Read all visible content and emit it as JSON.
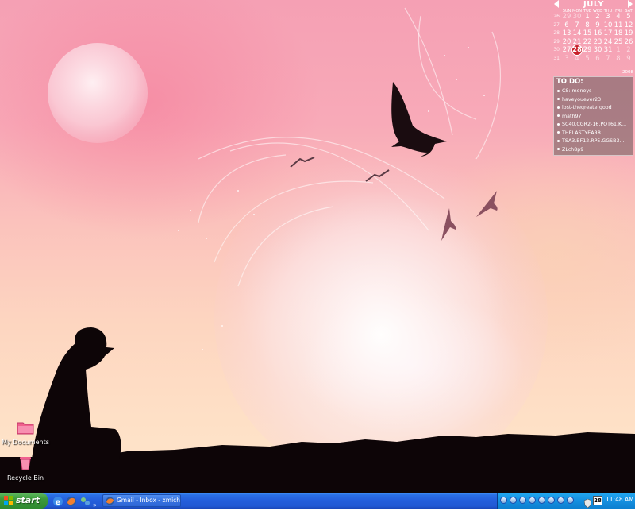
{
  "calendar": {
    "month": "JULY",
    "year": "2008",
    "weekday_headers": [
      "SUN",
      "MON",
      "TUE",
      "WED",
      "THU",
      "FRI",
      "SAT"
    ],
    "week_numbers": [
      "26",
      "27",
      "28",
      "29",
      "30",
      "31"
    ],
    "weeks": [
      [
        "29",
        "30",
        "1",
        "2",
        "3",
        "4",
        "5"
      ],
      [
        "6",
        "7",
        "8",
        "9",
        "10",
        "11",
        "12"
      ],
      [
        "13",
        "14",
        "15",
        "16",
        "17",
        "18",
        "19"
      ],
      [
        "20",
        "21",
        "22",
        "23",
        "24",
        "25",
        "26"
      ],
      [
        "27",
        "28",
        "29",
        "30",
        "31",
        "1",
        "2"
      ],
      [
        "3",
        "4",
        "5",
        "6",
        "7",
        "8",
        "9"
      ]
    ],
    "today": "28",
    "today_color": "#c8202a"
  },
  "todo": {
    "title": "TO DO:",
    "items": [
      "CS: moneys",
      "haveyouever23",
      "lost-thegreatergood",
      "math97",
      "SC40.CGR2-16.POT61.K...",
      "THELASTYEAR8",
      "TSA3.BF12.RP5.GGSB3...",
      "ZLch8p9"
    ]
  },
  "desktop_icons": [
    {
      "label": "My Documents",
      "icon": "folder-icon"
    },
    {
      "label": "Recycle Bin",
      "icon": "recycle-bin-icon"
    }
  ],
  "taskbar": {
    "start_label": "start",
    "quick_launch": [
      "internet-explorer-icon",
      "firefox-icon",
      "network-icon"
    ],
    "overflow": "»",
    "tasks": [
      {
        "label": "Gmail - Inbox - xmich...",
        "icon": "firefox-icon"
      }
    ],
    "tray_date": "28",
    "clock": "11:48 AM"
  },
  "colors": {
    "accent_pink": "#f5a0b4",
    "taskbar_blue": "#245edb",
    "start_green": "#3c9a3c",
    "tray_blue": "#1590e0"
  }
}
